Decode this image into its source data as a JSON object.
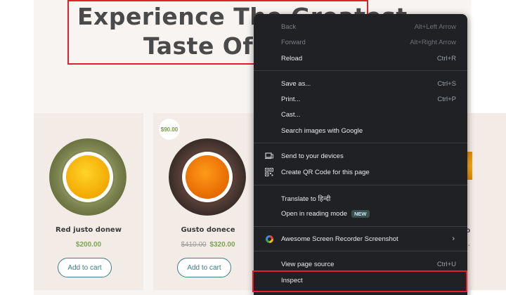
{
  "hero": {
    "title_line1": "Experience The Greatest",
    "title_line2": "Taste Of T"
  },
  "products": [
    {
      "name": "Red justo donew",
      "price": "$200.00",
      "old_price": "",
      "badge": "",
      "button": "Add to cart",
      "image": "green-tea-bowl"
    },
    {
      "name": "Gusto donece",
      "price": "$320.00",
      "old_price": "$410.00",
      "badge": "$90.00",
      "button": "Add to cart",
      "image": "black-tea-bowl"
    }
  ],
  "peek_product": {
    "name_partial": "o",
    "price_partial": "."
  },
  "context_menu": {
    "groups": [
      [
        {
          "label": "Back",
          "shortcut": "Alt+Left Arrow",
          "disabled": true
        },
        {
          "label": "Forward",
          "shortcut": "Alt+Right Arrow",
          "disabled": true
        },
        {
          "label": "Reload",
          "shortcut": "Ctrl+R",
          "disabled": false
        }
      ],
      [
        {
          "label": "Save as...",
          "shortcut": "Ctrl+S"
        },
        {
          "label": "Print...",
          "shortcut": "Ctrl+P"
        },
        {
          "label": "Cast...",
          "shortcut": ""
        },
        {
          "label": "Search images with Google",
          "shortcut": ""
        }
      ],
      [
        {
          "label": "Send to your devices",
          "icon": "devices-icon"
        },
        {
          "label": "Create QR Code for this page",
          "icon": "qr-code-icon"
        }
      ],
      [
        {
          "label": "Translate to हिन्दी"
        },
        {
          "label": "Open in reading mode",
          "badge": "NEW"
        }
      ],
      [
        {
          "label": "Awesome Screen Recorder  Screenshot",
          "icon": "screen-recorder-icon",
          "submenu": true
        }
      ],
      [
        {
          "label": "View page source",
          "shortcut": "Ctrl+U"
        },
        {
          "label": "Inspect",
          "shortcut": ""
        }
      ]
    ]
  },
  "colors": {
    "highlight_border": "#e0202a",
    "menu_bg": "#202124",
    "price_green": "#7fa255",
    "button_teal": "#3c7f86"
  }
}
